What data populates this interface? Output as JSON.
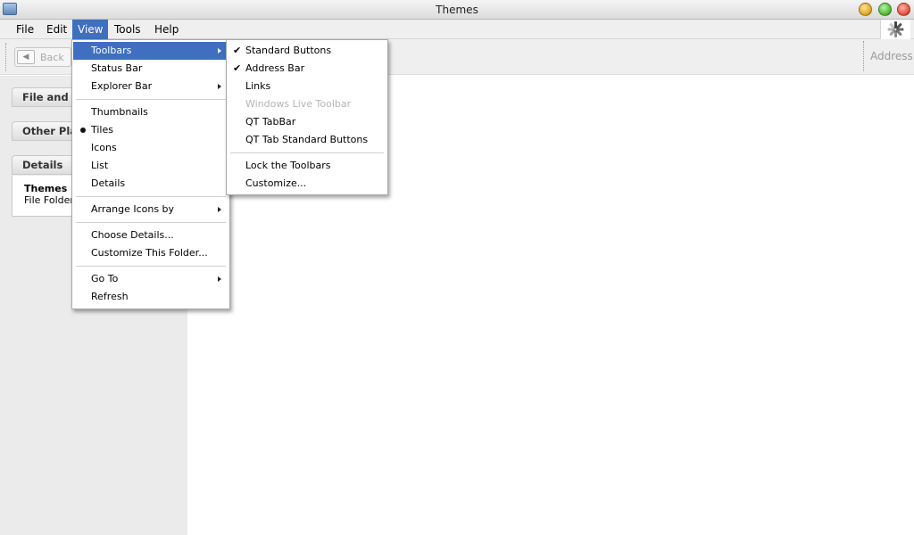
{
  "window": {
    "title": "Themes"
  },
  "menubar": {
    "items": [
      {
        "label": "File"
      },
      {
        "label": "Edit"
      },
      {
        "label": "View"
      },
      {
        "label": "Tools"
      },
      {
        "label": "Help"
      }
    ]
  },
  "toolbar": {
    "back_label": "Back",
    "address_label": "Address"
  },
  "sidebar": {
    "panels": [
      {
        "label": "File and Fo"
      },
      {
        "label": "Other Plac"
      },
      {
        "label": "Details"
      }
    ],
    "details": {
      "name": "Themes",
      "type": "File Folder"
    }
  },
  "view_menu": {
    "items": [
      "Toolbars",
      "Status Bar",
      "Explorer Bar",
      "Thumbnails",
      "Tiles",
      "Icons",
      "List",
      "Details",
      "Arrange Icons by",
      "Choose Details...",
      "Customize This Folder...",
      "Go To",
      "Refresh"
    ]
  },
  "toolbars_menu": {
    "items": [
      "Standard Buttons",
      "Address Bar",
      "Links",
      "Windows Live Toolbar",
      "QT TabBar",
      "QT Tab Standard Buttons",
      "Lock the Toolbars",
      "Customize..."
    ]
  },
  "colors": {
    "highlight": "#3f6fbf",
    "sidebar": "#ebebeb",
    "disabled": "#b4b4b4"
  },
  "icons": {
    "check": "✔",
    "left_arrow": "◀"
  }
}
